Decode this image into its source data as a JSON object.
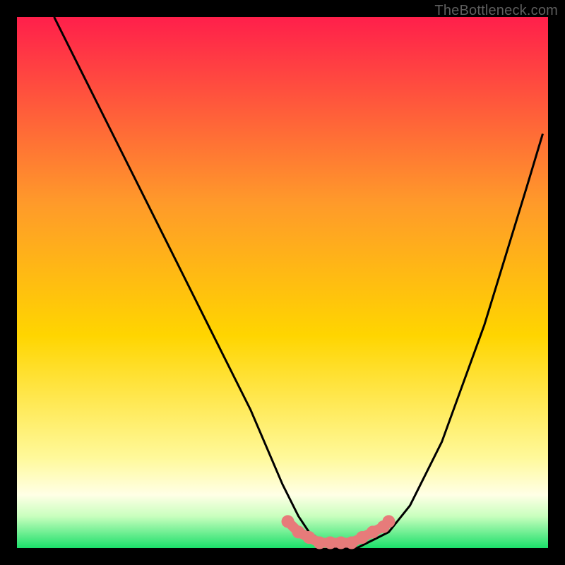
{
  "attribution": "TheBottleneck.com",
  "colors": {
    "gradient_top": "#ff1f4b",
    "gradient_mid1": "#ff7a2a",
    "gradient_mid2": "#ffd500",
    "gradient_mid3": "#fff99a",
    "gradient_bottom": "#1bdf6a",
    "frame": "#000000",
    "curve": "#000000",
    "marker": "#e77b7a"
  },
  "chart_data": {
    "type": "line",
    "title": "",
    "xlabel": "",
    "ylabel": "",
    "xlim": [
      0,
      100
    ],
    "ylim": [
      0,
      100
    ],
    "series": [
      {
        "name": "bottleneck-curve",
        "x": [
          7,
          12,
          20,
          28,
          36,
          44,
          50,
          53,
          55,
          58,
          60,
          62,
          64,
          66,
          68,
          70,
          74,
          80,
          88,
          96,
          99
        ],
        "y": [
          100,
          90,
          74,
          58,
          42,
          26,
          12,
          6,
          3,
          1,
          0,
          0,
          0,
          1,
          2,
          3,
          8,
          20,
          42,
          68,
          78
        ]
      }
    ],
    "highlight": {
      "name": "valley-markers",
      "x": [
        51,
        53,
        55,
        57,
        59,
        61,
        63,
        65,
        67,
        69,
        70
      ],
      "y": [
        5,
        3,
        2,
        1,
        1,
        1,
        1,
        2,
        3,
        4,
        5
      ]
    }
  }
}
